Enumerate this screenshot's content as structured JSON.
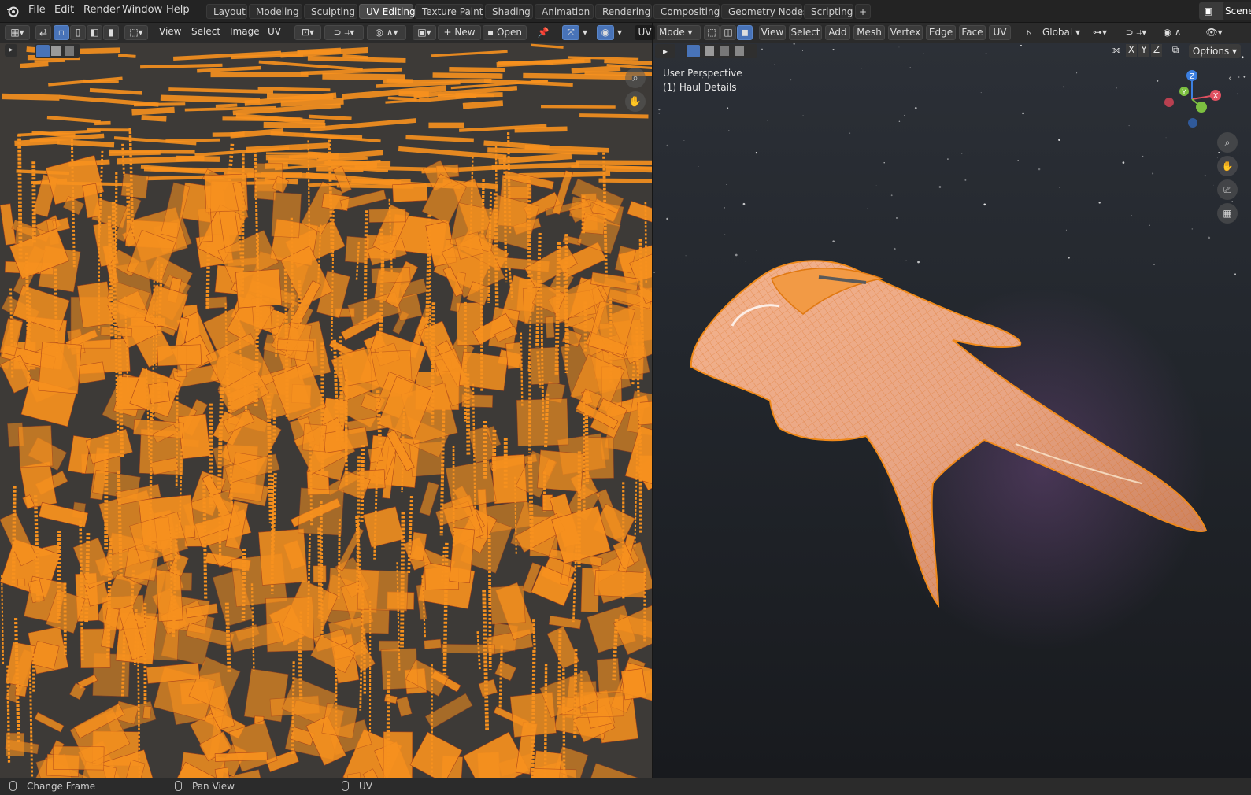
{
  "menubar": {
    "items": [
      "File",
      "Edit",
      "Render",
      "Window",
      "Help"
    ],
    "workspaces": [
      "Layout",
      "Modeling",
      "Sculpting",
      "UV Editing",
      "Texture Paint",
      "Shading",
      "Animation",
      "Rendering",
      "Compositing",
      "Geometry Nodes",
      "Scripting"
    ],
    "active_workspace": "UV Editing",
    "add_label": "+",
    "scene_label": "Scene"
  },
  "uv_header": {
    "menus": [
      "View",
      "Select",
      "Image",
      "UV"
    ],
    "new_label": "New",
    "open_label": "Open",
    "plus": "+"
  },
  "viewport_header": {
    "mode_label": "UV",
    "mode_value": "Mode",
    "menus": [
      "View",
      "Select",
      "Add",
      "Mesh",
      "Vertex",
      "Edge",
      "Face",
      "UV"
    ],
    "transform_orientation": "Global",
    "axes": [
      "X",
      "Y",
      "Z"
    ],
    "options_label": "Options"
  },
  "viewport": {
    "perspective": "User Perspective",
    "object": "(1) Haul Details",
    "gizmo": {
      "z": "Z",
      "y": "Y",
      "x": "X"
    }
  },
  "status_bar": {
    "items": [
      "Change Frame",
      "Pan View",
      "UV"
    ]
  },
  "colors": {
    "accent": "#f7911e",
    "active_tab": "#4a4a4a",
    "select_blue": "#4873b8"
  }
}
